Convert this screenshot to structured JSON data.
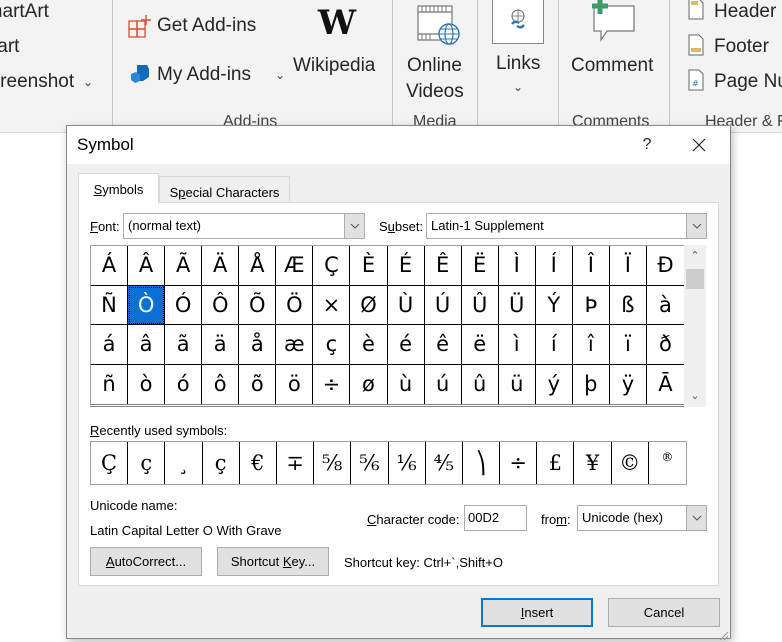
{
  "ribbon": {
    "insert_left": {
      "smartart": "SmartArt",
      "chart": "Chart",
      "screenshot": "Screenshot"
    },
    "addins": {
      "get_addins": "Get Add-ins",
      "my_addins": "My Add-ins",
      "wikipedia": "Wikipedia",
      "group_label": "Add-ins"
    },
    "media": {
      "online_videos_line1": "Online",
      "online_videos_line2": "Videos",
      "group_label": "Media"
    },
    "links": {
      "label": "Links"
    },
    "comments": {
      "comment": "Comment",
      "group_label": "Comments"
    },
    "header_footer": {
      "header": "Header",
      "footer": "Footer",
      "page_number": "Page Number",
      "group_label": "Header & Footer"
    },
    "colors": {
      "addin_orange": "#d35230",
      "addin_blue": "#0f6cbd",
      "comment_green": "#3c9a6e"
    }
  },
  "dialog": {
    "title": "Symbol",
    "help": "?",
    "tabs": [
      {
        "label": "Symbols",
        "accesskey": "S",
        "active": true
      },
      {
        "label": "Special Characters",
        "accesskey": "p",
        "active": false
      }
    ],
    "font": {
      "label": "Font:",
      "value": "(normal text)"
    },
    "subset": {
      "label": "Subset:",
      "value": "Latin-1 Supplement"
    },
    "symbol_grid": [
      [
        "Á",
        "Â",
        "Ã",
        "Ä",
        "Å",
        "Æ",
        "Ç",
        "È",
        "É",
        "Ê",
        "Ë",
        "Ì",
        "Í",
        "Î",
        "Ï",
        "Ð"
      ],
      [
        "Ñ",
        "Ò",
        "Ó",
        "Ô",
        "Õ",
        "Ö",
        "×",
        "Ø",
        "Ù",
        "Ú",
        "Û",
        "Ü",
        "Ý",
        "Þ",
        "ß",
        "à"
      ],
      [
        "á",
        "â",
        "ã",
        "ä",
        "å",
        "æ",
        "ç",
        "è",
        "é",
        "ê",
        "ë",
        "ì",
        "í",
        "î",
        "ï",
        "ð"
      ],
      [
        "ñ",
        "ò",
        "ó",
        "ô",
        "õ",
        "ö",
        "÷",
        "ø",
        "ù",
        "ú",
        "û",
        "ü",
        "ý",
        "þ",
        "ÿ",
        "Ā"
      ]
    ],
    "selected": {
      "row": 1,
      "col": 1,
      "char": "Ò"
    },
    "recent_label": "Recently used symbols:",
    "recent_symbols": [
      "Ç",
      "ç",
      "¸",
      "ç",
      "€",
      "∓",
      "⅝",
      "⅚",
      "⅙",
      "⅘",
      "⎞",
      "÷",
      "£",
      "¥",
      "©",
      "®"
    ],
    "unicode_name_label": "Unicode name:",
    "unicode_name_value": "Latin Capital Letter O With Grave",
    "character_code_label": "Character code:",
    "character_code_value": "00D2",
    "from_label": "from:",
    "from_value": "Unicode (hex)",
    "autocorrect_button": "AutoCorrect...",
    "shortcut_key_button": "Shortcut Key...",
    "shortcut_key_text": "Shortcut key: Ctrl+`,Shift+O",
    "insert_button": "Insert",
    "cancel_button": "Cancel",
    "selection_color": "#0a6fd6",
    "default_button_border": "#0078d7"
  }
}
